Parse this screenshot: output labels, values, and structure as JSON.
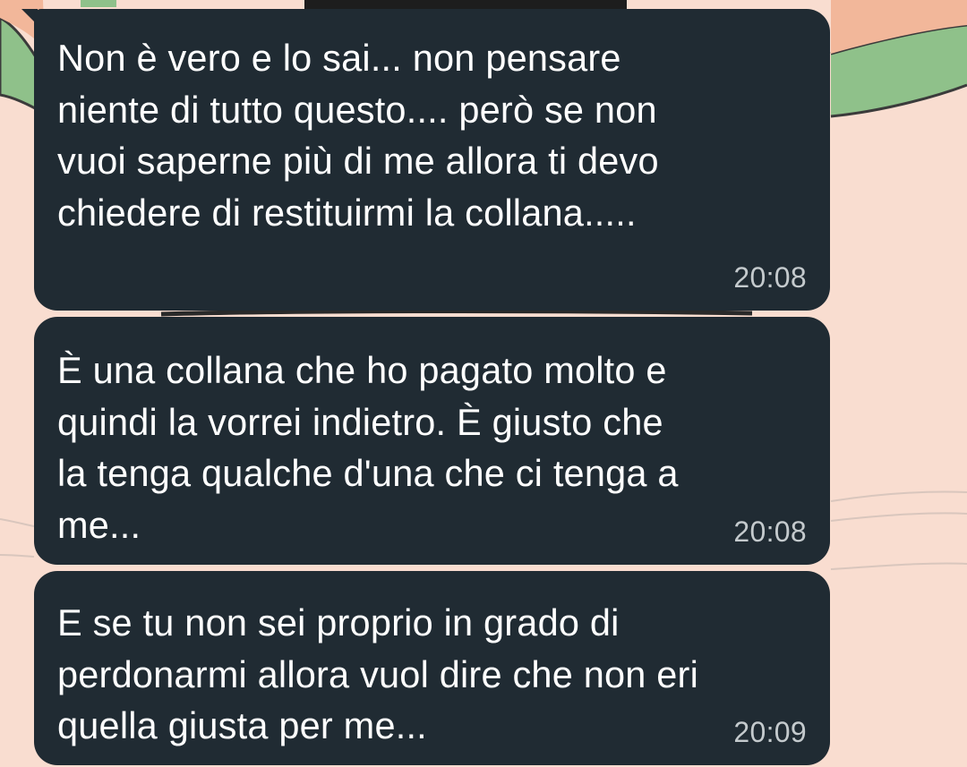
{
  "theme": {
    "wallpaper_color": "#f9ddd0",
    "bubble_color": "#202b33",
    "text_color": "#ffffff",
    "time_color": "#c4cacd"
  },
  "messages": [
    {
      "text": "Non è vero e lo sai... non pensare\nniente di tutto questo.... però se non\nvuoi saperne più di me allora ti devo\nchiedere di restituirmi la collana.....",
      "time": "20:08"
    },
    {
      "text": "È una collana che ho pagato molto e\nquindi la vorrei indietro. È giusto che\nla tenga qualche d'una che ci tenga a\nme...",
      "time": "20:08"
    },
    {
      "text": "E se tu non sei proprio in grado di\nperdonarmi allora vuol dire che non eri\nquella giusta per me...",
      "time": "20:09"
    }
  ]
}
